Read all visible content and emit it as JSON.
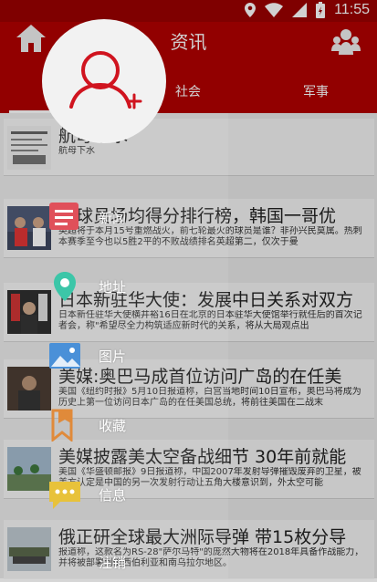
{
  "status_bar": {
    "time": "11:55",
    "icons": [
      "location-icon",
      "wifi-icon",
      "signal-icon",
      "battery-icon"
    ]
  },
  "appbar": {
    "title": "资讯"
  },
  "tabs": [
    {
      "label": "主页"
    },
    {
      "label": "社会"
    },
    {
      "label": "军事"
    }
  ],
  "news": [
    {
      "title": "航母下水",
      "desc": "航母下水"
    },
    {
      "title": "超球员场均得分排行榜，韩国一哥优",
      "desc": "英超将于本月15号重燃战火，前七轮最火的球员是谁？非孙兴民莫属。热刺本赛季至今也以5胜2平的不败战绩排名英超第二，仅次于曼"
    },
    {
      "title": "日本新驻华大使：发展中日关系对双方",
      "desc": "日本新任驻华大使横井裕16日在北京的日本驻华大使馆举行就任后的首次记者会，称\"希望尽全力构筑适应新时代的关系，将从大局观点出"
    },
    {
      "title": "美媒:奥巴马成首位访问广岛的在任美",
      "desc": "美国《纽约时报》5月10日报道称，白宫当地时间10日宣布，奥巴马将成为历史上第一位访问日本广岛的在任美国总统，将前往美国在二战末"
    },
    {
      "title": "美媒披露美太空备战细节 30年前就能",
      "desc": "美国《华盛顿邮报》9日报道称，中国2007年发射导弹摧毁废弃的卫星，被美方认定是中国的另一次发射行动让五角大楼意识到，外太空可能"
    },
    {
      "title": "俄正研全球最大洲际导弹 带15枚分导",
      "desc": "报道称，这款名为RS-28\"萨尔马特\"的庞然大物将在2018年具备作战能力，并将被部署到俄西伯利亚和南乌拉尔地区。"
    }
  ],
  "drawer": {
    "avatar_icon": "add-user-icon",
    "menu": [
      {
        "label": "新闻",
        "icon": "news-icon",
        "color": "#e0505a"
      },
      {
        "label": "地址",
        "icon": "location-pin-icon",
        "color": "#3cc6a8"
      },
      {
        "label": "图片",
        "icon": "image-icon",
        "color": "#4a90d8"
      },
      {
        "label": "收藏",
        "icon": "bookmark-icon",
        "color": "#e08a3a"
      },
      {
        "label": "信息",
        "icon": "message-icon",
        "color": "#e8c23a"
      },
      {
        "label": "注销",
        "icon": "logout-icon",
        "color": "#ffffff"
      }
    ]
  },
  "colors": {
    "primary": "#b30000",
    "status": "#9b0000",
    "accent": "#d0141f"
  }
}
